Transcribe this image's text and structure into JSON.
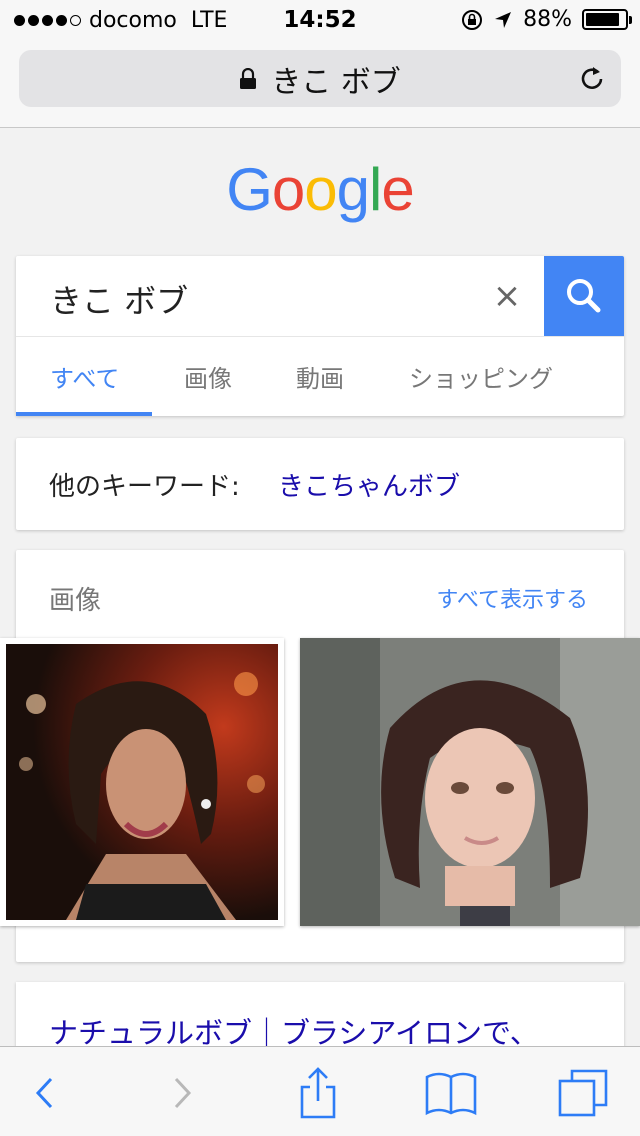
{
  "status": {
    "carrier": "docomo",
    "network": "LTE",
    "time": "14:52",
    "battery": "88%",
    "battery_level": 0.88,
    "icons": [
      "orientation-lock-icon",
      "location-arrow-icon",
      "battery-icon"
    ]
  },
  "browser": {
    "url_title": "きこ ボブ",
    "toolbar_icons": [
      "back-icon",
      "forward-icon",
      "share-icon",
      "bookmarks-icon",
      "tabs-icon"
    ]
  },
  "logo": [
    "G",
    "o",
    "o",
    "g",
    "l",
    "e"
  ],
  "search": {
    "query": "きこ ボブ",
    "clear": "×",
    "tabs": [
      "すべて",
      "画像",
      "動画",
      "ショッピング"
    ]
  },
  "keyword": {
    "label": "他のキーワード:",
    "link": "きこちゃんボブ"
  },
  "images": {
    "title": "画像",
    "show_all": "すべて表示する"
  },
  "result": {
    "title": "ナチュラルボブ｜ブラシアイロンで、"
  },
  "colors": {
    "accent": "#4285f4",
    "link": "#1a0dab",
    "ios_blue": "#2d7cf6"
  }
}
